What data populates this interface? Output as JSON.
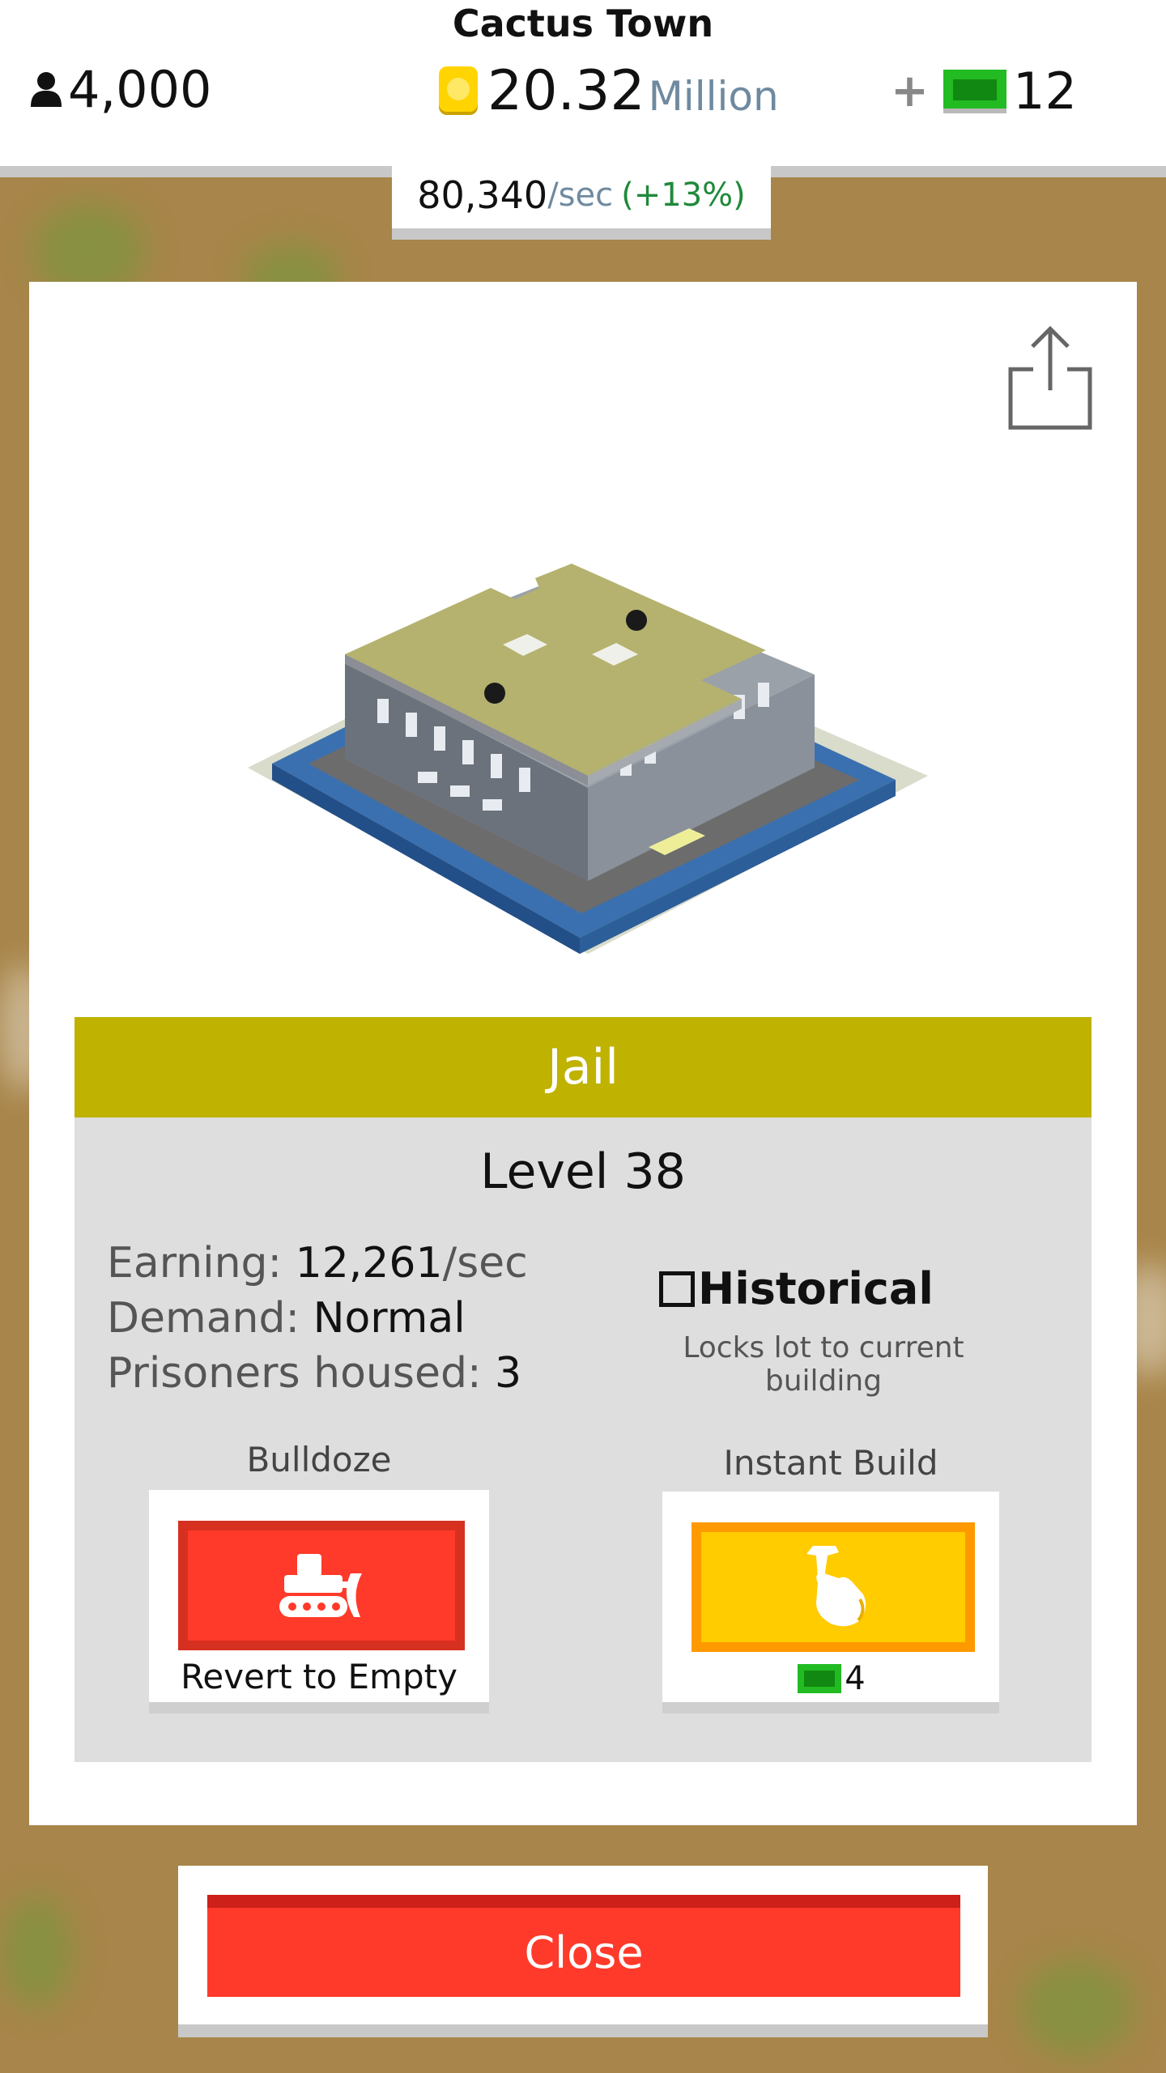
{
  "header": {
    "town_name": "Cactus Town",
    "population": "4,000",
    "money_value": "20.32",
    "money_unit": "Million",
    "cash": "12",
    "plus_label": "+",
    "rate_value": "80,340",
    "rate_unit": "/sec",
    "rate_bonus": "(+13%)"
  },
  "building": {
    "name": "Jail",
    "level": "Level 38",
    "earning_label": "Earning:",
    "earning_value": "12,261",
    "earning_unit": "/sec",
    "demand_label": "Demand:",
    "demand_value": "Normal",
    "prisoners_label": "Prisoners housed:",
    "prisoners_value": "3",
    "historical_label": "Historical",
    "historical_checked": false,
    "historical_sub": "Locks lot to current building"
  },
  "actions": {
    "bulldoze_label": "Bulldoze",
    "bulldoze_button_text": "Revert to Empty",
    "instant_build_label": "Instant Build",
    "instant_build_cost": "4"
  },
  "close_label": "Close",
  "colors": {
    "title_bar": "#bfb200",
    "close_red": "#ff3a2a",
    "instant_yellow": "#ffcc00",
    "cash_green": "#22bb22"
  }
}
